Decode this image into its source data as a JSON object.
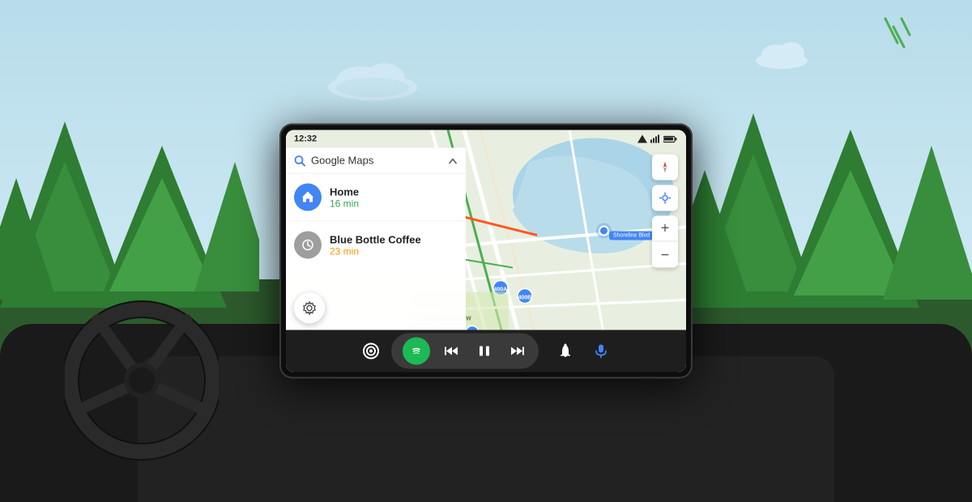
{
  "scene": {
    "sky_color": "#c8e8f5",
    "ground_color": "#2e4a2e"
  },
  "status_bar": {
    "time": "12:32",
    "signal_icon": "▼",
    "wifi_icon": "▲",
    "battery_icon": "▮"
  },
  "search": {
    "label": "Google Maps",
    "chevron": "^"
  },
  "destinations": [
    {
      "name": "Home",
      "time": "16 min",
      "time_color": "green",
      "icon": "home"
    },
    {
      "name": "Blue Bottle Coffee",
      "time": "23 min",
      "time_color": "orange",
      "icon": "history"
    }
  ],
  "map_controls": {
    "compass_label": "N",
    "location_label": "⊙",
    "zoom_in": "+",
    "zoom_out": "−"
  },
  "map_labels": {
    "shoreline_blvd": "Shoreline Blvd",
    "greenmeadow": "GREENMEADOW"
  },
  "nav_bar": {
    "android_icon": "android",
    "spotify_icon": "spotify",
    "prev_icon": "prev",
    "pause_icon": "pause",
    "next_icon": "next",
    "bell_icon": "bell",
    "mic_icon": "mic"
  },
  "settings_icon": "gear"
}
